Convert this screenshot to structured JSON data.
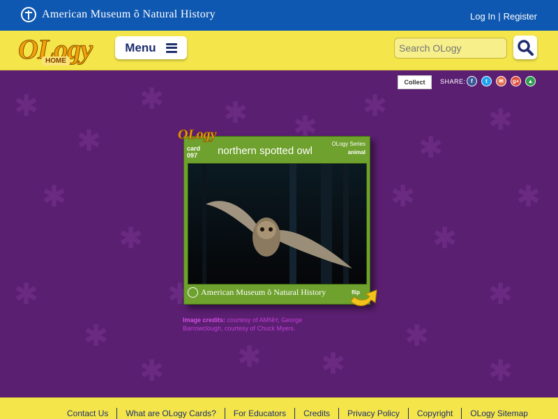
{
  "topbar": {
    "brand": "American Museum õ Natural History",
    "login": "Log In",
    "separator": "|",
    "register": "Register",
    "bg_color": "#0f58b1"
  },
  "header": {
    "logo": "OLogy",
    "home_label": "HOME",
    "menu_label": "Menu",
    "search_placeholder": "Search OLogy"
  },
  "share": {
    "collect_label": "Collect",
    "share_label": "SHARE:",
    "icons": [
      "facebook-icon",
      "twitter-icon",
      "email-icon",
      "google-plus-icon",
      "classroom-icon"
    ]
  },
  "card": {
    "badge": "OLogy",
    "card_label": "card",
    "card_number": "097",
    "title": "northern spotted owl",
    "series_label": "OLogy Series",
    "category": "animal",
    "brand": "American Museum õ Natural History",
    "flip_label": "flip",
    "frame_color": "#6ea12d"
  },
  "credits": {
    "label": "Image credits:",
    "text": " courtesy of AMNH; George Barrowclough, courtesy of Chuck Myers."
  },
  "footer": {
    "links": [
      "Contact Us",
      "What are OLogy Cards?",
      "For Educators",
      "Credits",
      "Privacy Policy",
      "Copyright",
      "OLogy Sitemap"
    ]
  }
}
